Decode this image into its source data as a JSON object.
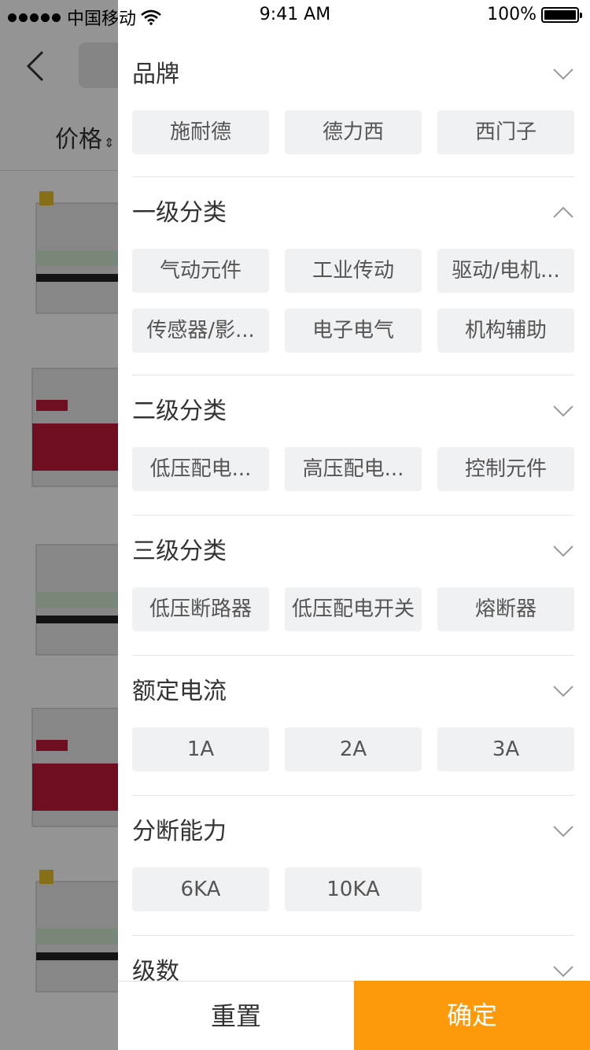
{
  "status_bar": {
    "carrier": "中国移动",
    "time": "9:41 AM",
    "battery": "100%",
    "battery_level": 1.0
  },
  "background_page": {
    "sort_label": "价格",
    "sort_icon": "sort-arrows-icon"
  },
  "filters": [
    {
      "title": "品牌",
      "expanded": false,
      "options": [
        "施耐德",
        "德力西",
        "西门子"
      ]
    },
    {
      "title": "一级分类",
      "expanded": true,
      "options": [
        "气动元件",
        "工业传动",
        "驱动/电机...",
        "传感器/影...",
        "电子电气",
        "机构辅助"
      ]
    },
    {
      "title": "二级分类",
      "expanded": false,
      "options": [
        "低压配电...",
        "高压配电...",
        "控制元件"
      ]
    },
    {
      "title": "三级分类",
      "expanded": false,
      "options": [
        "低压断路器",
        "低压配电开关",
        "熔断器"
      ]
    },
    {
      "title": "额定电流",
      "expanded": false,
      "options": [
        "1A",
        "2A",
        "3A"
      ]
    },
    {
      "title": "分断能力",
      "expanded": false,
      "options": [
        "6KA",
        "10KA"
      ]
    },
    {
      "title": "级数",
      "expanded": false,
      "options": []
    }
  ],
  "footer": {
    "reset_label": "重置",
    "confirm_label": "确定",
    "confirm_color": "#fc9a0b"
  }
}
